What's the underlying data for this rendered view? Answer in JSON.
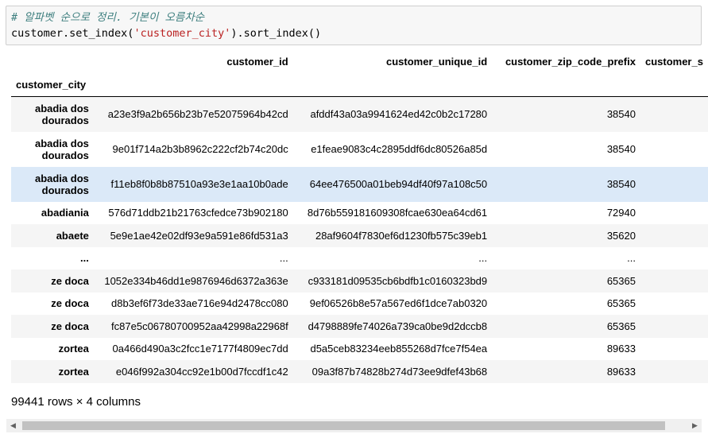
{
  "code_cell": {
    "comment": "# 알파벳 순으로 정리. 기본이 오름차순",
    "code_prefix": "customer.set_index(",
    "code_string": "'customer_city'",
    "code_suffix": ").sort_index()"
  },
  "dataframe": {
    "columns": [
      "customer_id",
      "customer_unique_id",
      "customer_zip_code_prefix",
      "customer_s"
    ],
    "index_name": "customer_city",
    "rows": [
      {
        "index": "abadia dos dourados",
        "customer_id": "a23e3f9a2b656b23b7e52075964b42cd",
        "customer_unique_id": "afddf43a03a9941624ed42c0b2c17280",
        "zip": "38540"
      },
      {
        "index": "abadia dos dourados",
        "customer_id": "9e01f714a2b3b8962c222cf2b74c20dc",
        "customer_unique_id": "e1feae9083c4c2895ddf6dc80526a85d",
        "zip": "38540"
      },
      {
        "index": "abadia dos dourados",
        "customer_id": "f11eb8f0b8b87510a93e3e1aa10b0ade",
        "customer_unique_id": "64ee476500a01beb94df40f97a108c50",
        "zip": "38540"
      },
      {
        "index": "abadiania",
        "customer_id": "576d71ddb21b21763cfedce73b902180",
        "customer_unique_id": "8d76b559181609308fcae630ea64cd61",
        "zip": "72940"
      },
      {
        "index": "abaete",
        "customer_id": "5e9e1ae42e02df93e9a591e86fd531a3",
        "customer_unique_id": "28af9604f7830ef6d1230fb575c39eb1",
        "zip": "35620"
      },
      {
        "index": "...",
        "customer_id": "...",
        "customer_unique_id": "...",
        "zip": "..."
      },
      {
        "index": "ze doca",
        "customer_id": "1052e334b46dd1e9876946d6372a363e",
        "customer_unique_id": "c933181d09535cb6bdfb1c0160323bd9",
        "zip": "65365"
      },
      {
        "index": "ze doca",
        "customer_id": "d8b3ef6f73de33ae716e94d2478cc080",
        "customer_unique_id": "9ef06526b8e57a567ed6f1dce7ab0320",
        "zip": "65365"
      },
      {
        "index": "ze doca",
        "customer_id": "fc87e5c06780700952aa42998a22968f",
        "customer_unique_id": "d4798889fe74026a739ca0be9d2dccb8",
        "zip": "65365"
      },
      {
        "index": "zortea",
        "customer_id": "0a466d490a3c2fcc1e7177f4809ec7dd",
        "customer_unique_id": "d5a5ceb83234eeb855268d7fce7f54ea",
        "zip": "89633"
      },
      {
        "index": "zortea",
        "customer_id": "e046f992a304cc92e1b00d7fccdf1c42",
        "customer_unique_id": "09a3f87b74828b274d73ee9dfef43b68",
        "zip": "89633"
      }
    ]
  },
  "summary": "99441 rows × 4 columns",
  "scrollbar": {
    "left_arrow": "◀",
    "right_arrow": "▶"
  }
}
